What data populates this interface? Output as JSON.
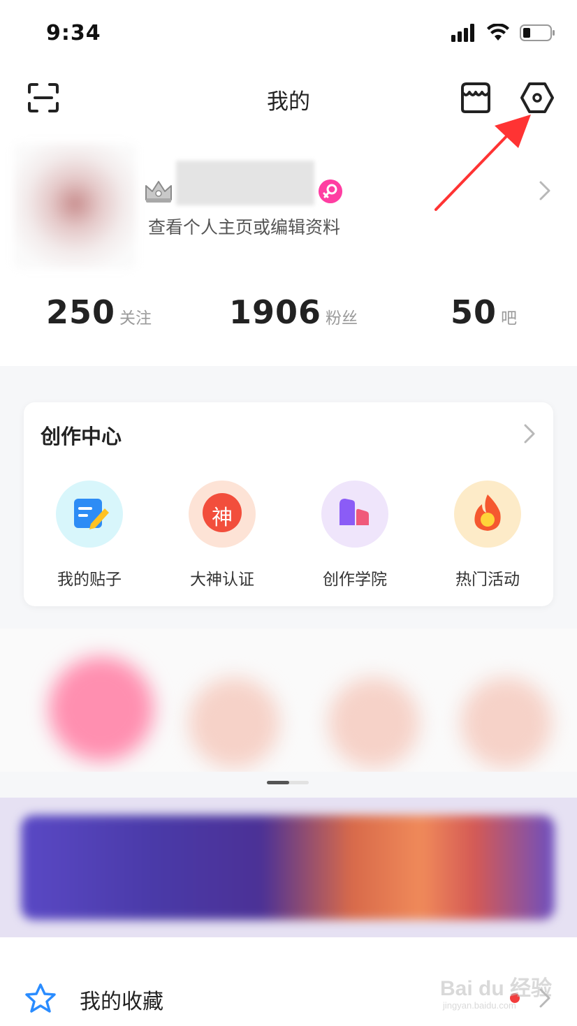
{
  "status_bar": {
    "time": "9:34",
    "icons": [
      "cellular-signal-icon",
      "wifi-icon",
      "battery-icon"
    ]
  },
  "nav": {
    "title": "我的",
    "left_icon": "scan-icon",
    "right_icons": [
      "shop-icon",
      "settings-icon"
    ]
  },
  "profile": {
    "subtitle": "查看个人主页或编辑资料",
    "badge_icon": "crown-icon",
    "gender_icon": "female-icon"
  },
  "stats": [
    {
      "value": "250",
      "label": "关注"
    },
    {
      "value": "1906",
      "label": "粉丝"
    },
    {
      "value": "50",
      "label": "吧"
    }
  ],
  "creation_center": {
    "title": "创作中心",
    "tools": [
      {
        "label": "我的贴子",
        "icon": "edit-note-icon"
      },
      {
        "label": "大神认证",
        "icon": "shen-badge-icon",
        "icon_text": "神"
      },
      {
        "label": "创作学院",
        "icon": "academy-chart-icon"
      },
      {
        "label": "热门活动",
        "icon": "fire-icon"
      }
    ]
  },
  "list": {
    "favorites_label": "我的收藏",
    "favorites_icon": "star-icon"
  },
  "watermark": {
    "brand": "Bai du 经验",
    "url": "jingyan.baidu.com"
  },
  "colors": {
    "accent_red": "#f23c3c",
    "gender_pink": "#ff3ea2",
    "star_blue": "#2a8cff"
  }
}
